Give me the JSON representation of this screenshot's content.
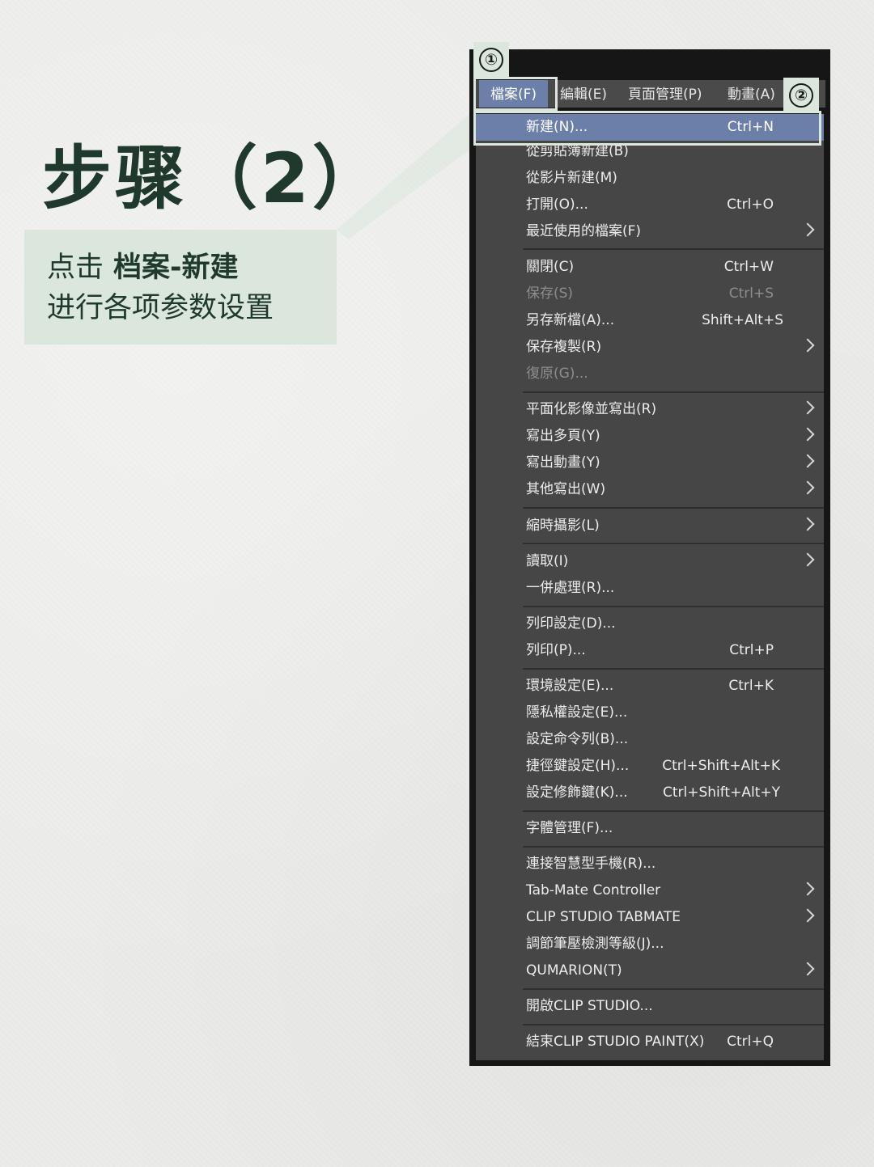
{
  "title": "步骤（2）",
  "callout": {
    "prefix": "点击",
    "emphasis": "档案-新建",
    "line2": "进行各项参数设置"
  },
  "badges": {
    "first": "①",
    "second": "②"
  },
  "menubar": [
    {
      "label": "檔案(F)"
    },
    {
      "label": "編輯(E)"
    },
    {
      "label": "頁面管理(P)"
    },
    {
      "label": "動畫(A)"
    }
  ],
  "menu": [
    {
      "label": "新建(N)...",
      "shortcut": "Ctrl+N"
    },
    {
      "label": "從剪貼簿新建(B)",
      "shortcut": ""
    },
    {
      "label": "從影片新建(M)",
      "shortcut": ""
    },
    {
      "label": "打開(O)...",
      "shortcut": "Ctrl+O"
    },
    {
      "label": "最近使用的檔案(F)",
      "shortcut": ""
    },
    {
      "label": "關閉(C)",
      "shortcut": "Ctrl+W"
    },
    {
      "label": "保存(S)",
      "shortcut": "Ctrl+S"
    },
    {
      "label": "另存新檔(A)...",
      "shortcut": "Shift+Alt+S"
    },
    {
      "label": "保存複製(R)",
      "shortcut": ""
    },
    {
      "label": "復原(G)...",
      "shortcut": ""
    },
    {
      "label": "平面化影像並寫出(R)",
      "shortcut": ""
    },
    {
      "label": "寫出多頁(Y)",
      "shortcut": ""
    },
    {
      "label": "寫出動畫(Y)",
      "shortcut": ""
    },
    {
      "label": "其他寫出(W)",
      "shortcut": ""
    },
    {
      "label": "縮時攝影(L)",
      "shortcut": ""
    },
    {
      "label": "讀取(I)",
      "shortcut": ""
    },
    {
      "label": "一併處理(R)...",
      "shortcut": ""
    },
    {
      "label": "列印設定(D)...",
      "shortcut": ""
    },
    {
      "label": "列印(P)...",
      "shortcut": "Ctrl+P"
    },
    {
      "label": "環境設定(E)...",
      "shortcut": "Ctrl+K"
    },
    {
      "label": "隱私權設定(E)...",
      "shortcut": ""
    },
    {
      "label": "設定命令列(B)...",
      "shortcut": ""
    },
    {
      "label": "捷徑鍵設定(H)...",
      "shortcut": "Ctrl+Shift+Alt+K"
    },
    {
      "label": "設定修飾鍵(K)...",
      "shortcut": "Ctrl+Shift+Alt+Y"
    },
    {
      "label": "字體管理(F)...",
      "shortcut": ""
    },
    {
      "label": "連接智慧型手機(R)...",
      "shortcut": ""
    },
    {
      "label": "Tab-Mate Controller",
      "shortcut": ""
    },
    {
      "label": "CLIP STUDIO TABMATE",
      "shortcut": ""
    },
    {
      "label": "調節筆壓檢測等級(J)...",
      "shortcut": ""
    },
    {
      "label": "QUMARION(T)",
      "shortcut": ""
    },
    {
      "label": "開啟CLIP STUDIO...",
      "shortcut": ""
    },
    {
      "label": "結束CLIP STUDIO PAINT(X)",
      "shortcut": "Ctrl+Q"
    }
  ],
  "colors": {
    "accent_green": "#dbe7dc",
    "title_green": "#1f3a2c",
    "menu_highlight": "#6c7fa8",
    "menu_bg": "#464646"
  }
}
